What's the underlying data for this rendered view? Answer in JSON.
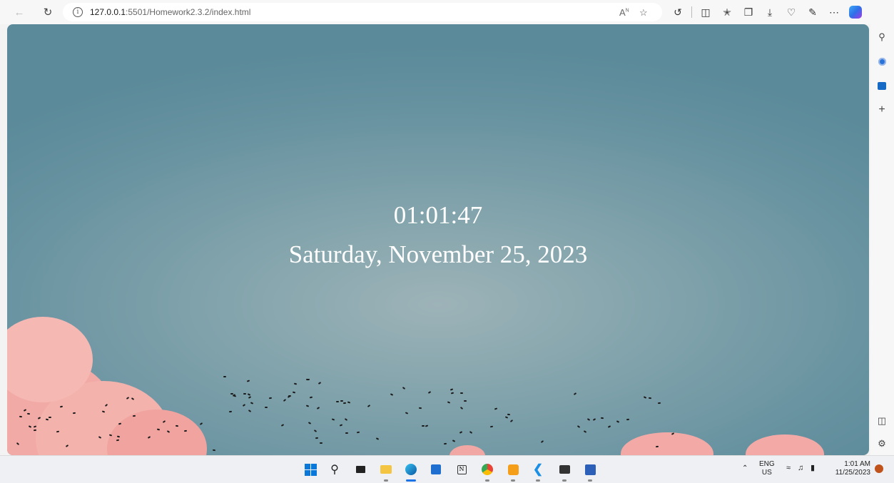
{
  "browser": {
    "url_host": "127.0.0.1",
    "url_path": ":5501/Homework2.3.2/index.html",
    "read_aloud_label": "A",
    "read_aloud_sup": "N"
  },
  "clock": {
    "time": "01:01:47",
    "date": "Saturday, November 25, 2023"
  },
  "taskbar": {
    "lang_top": "ENG",
    "lang_bottom": "US",
    "clock_time": "1:01 AM",
    "clock_date": "11/25/2023"
  },
  "colors": {
    "sky": "#6f97a4",
    "cloud": "#f2a9a4",
    "clock_text": "#ffffff"
  }
}
